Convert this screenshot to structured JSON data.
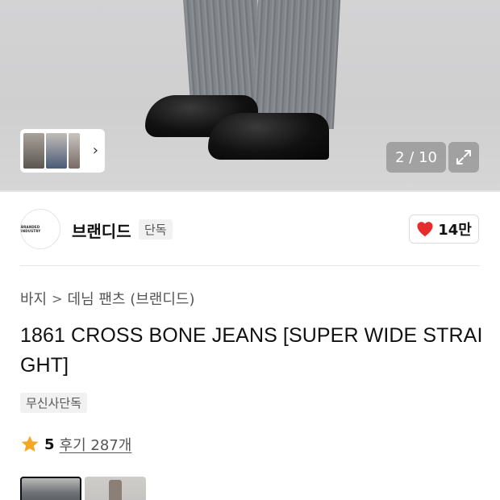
{
  "gallery": {
    "counter": "2 / 10",
    "thumbnail_chevron": "›",
    "expand_icon": "expand-icon"
  },
  "brand": {
    "logo_text": "BRANDED INDUSTRY",
    "name": "브랜디드",
    "badge": "단독",
    "like_count": "14만",
    "like_color": "#e52d2d"
  },
  "breadcrumb": {
    "items": [
      "바지",
      "데님 팬츠 (브랜디드)"
    ],
    "separator": ">"
  },
  "product": {
    "title": "1861 CROSS BONE JEANS [SUPER WIDE STRAIGHT]",
    "exclusive_tag": "무신사단독"
  },
  "rating": {
    "score": "5",
    "review_label": "후기 287개",
    "star_color": "#f5a623"
  }
}
